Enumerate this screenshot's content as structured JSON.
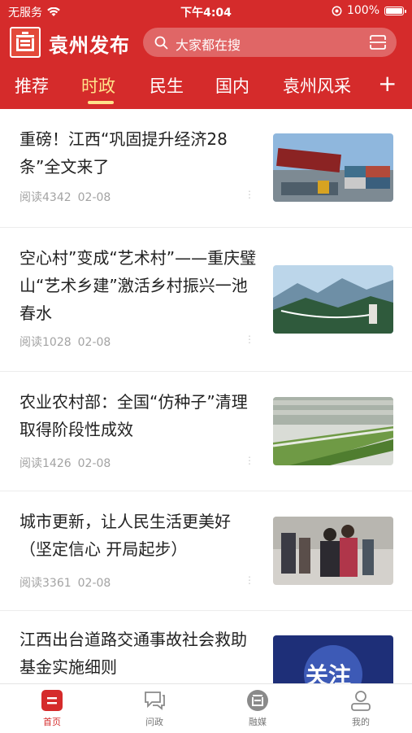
{
  "status_bar": {
    "carrier": "无服务",
    "time": "下午4:04",
    "battery": "100%",
    "battery_level": 1.0
  },
  "header": {
    "app_title": "袁州发布",
    "logo_icon": "yuanzhou-logo-icon",
    "search_placeholder": "大家都在搜",
    "colors": {
      "primary": "#d52b2b",
      "active_tab": "#ffe28a"
    }
  },
  "tabs": [
    {
      "label": "推荐",
      "active": false
    },
    {
      "label": "时政",
      "active": true
    },
    {
      "label": "民生",
      "active": false
    },
    {
      "label": "国内",
      "active": false
    },
    {
      "label": "袁州风采",
      "active": false
    }
  ],
  "tab_add_label": "+",
  "articles": [
    {
      "title": "重磅！江西“巩固提升经济28条”全文来了",
      "reads": "阅读4342",
      "date": "02-08",
      "thumbnail": "shipping-containers-port"
    },
    {
      "title": "空心村”变成“艺术村”——重庆璧山“艺术乡建”激活乡村振兴一池春水",
      "reads": "阅读1028",
      "date": "02-08",
      "thumbnail": "mountain-glass-bridge"
    },
    {
      "title": "农业农村部：全国“仿种子”清理取得阶段性成效",
      "reads": "阅读1426",
      "date": "02-08",
      "thumbnail": "greenhouse-seedlings"
    },
    {
      "title": "城市更新，让人民生活更美好（坚定信心 开局起步）",
      "reads": "阅读3361",
      "date": "02-08",
      "thumbnail": "street-people-hugging"
    },
    {
      "title": "江西出台道路交通事故社会救助基金实施细则",
      "reads": "",
      "date": "",
      "thumbnail": "follow-badge",
      "thumb_text": "关注"
    }
  ],
  "tabbar": [
    {
      "label": "首页",
      "icon": "home-icon",
      "active": true
    },
    {
      "label": "问政",
      "icon": "chat-bubble-icon",
      "active": false
    },
    {
      "label": "融媒",
      "icon": "media-logo-icon",
      "active": false
    },
    {
      "label": "我的",
      "icon": "profile-icon",
      "active": false
    }
  ]
}
